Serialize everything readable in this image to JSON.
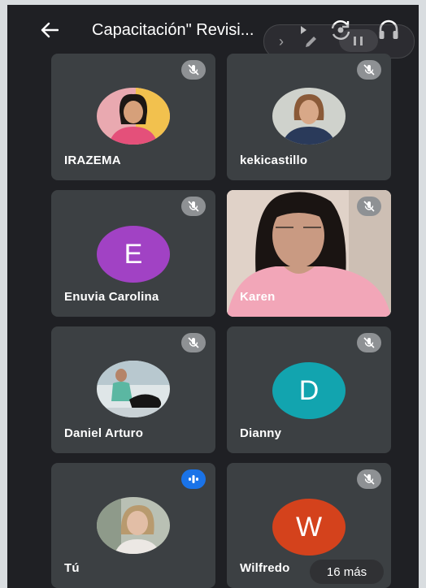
{
  "header": {
    "title": "Capacitación\" Revisi..."
  },
  "overlay": {
    "icons": [
      "chevron-right-icon",
      "pencil-icon",
      "pause-icon"
    ]
  },
  "participants": [
    {
      "name": "IRAZEMA",
      "mic": "muted",
      "avatar": "photo"
    },
    {
      "name": "kekicastillo",
      "mic": "muted",
      "avatar": "photo"
    },
    {
      "name": "Enuvia Carolina",
      "mic": "muted",
      "avatar": "letter",
      "initial": "E",
      "color": "#a142c4"
    },
    {
      "name": "Karen",
      "mic": "muted",
      "avatar": "video"
    },
    {
      "name": "Daniel Arturo",
      "mic": "muted",
      "avatar": "photo"
    },
    {
      "name": "Dianny",
      "mic": "muted",
      "avatar": "letter",
      "initial": "D",
      "color": "#12a4af"
    },
    {
      "name": "Tú",
      "mic": "speaking",
      "avatar": "photo"
    },
    {
      "name": "Wilfredo",
      "mic": "muted",
      "avatar": "letter",
      "initial": "W",
      "color": "#d4421c"
    }
  ],
  "more_label": "16 más",
  "colors": {
    "background": "#1f2024",
    "tile": "#3c4043",
    "speaking": "#1a73e8"
  }
}
